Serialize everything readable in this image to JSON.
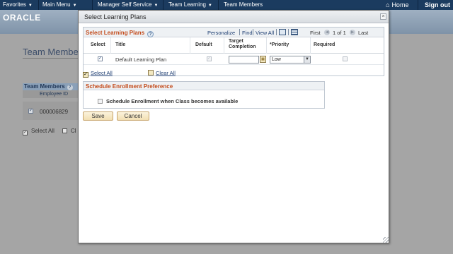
{
  "topbar": {
    "menus": [
      {
        "label": "Favorites"
      },
      {
        "label": "Main Menu"
      },
      {
        "label": "Manager Self Service"
      },
      {
        "label": "Team Learning"
      },
      {
        "label": "Team Members"
      }
    ],
    "home_label": "Home",
    "signout_label": "Sign out"
  },
  "brand": {
    "logo_text": "ORACLE"
  },
  "background_page": {
    "title": "Team Members",
    "grid_title": "Team Members",
    "column_employee_id": "Employee ID",
    "employee_id": "000006829",
    "select_all_label": "Select All",
    "clear_all_partial": "Cl"
  },
  "modal": {
    "title": "Select Learning Plans",
    "close_glyph": "×",
    "grid": {
      "title": "Select Learning Plans",
      "personalize": "Personalize",
      "find": "Find",
      "view_all": "View All",
      "first": "First",
      "page_info": "1 of 1",
      "last": "Last",
      "columns": {
        "select": "Select",
        "title": "Title",
        "default": "Default",
        "target_completion_1": "Target",
        "target_completion_2": "Completion",
        "priority": "*Priority",
        "required": "Required"
      },
      "rows": [
        {
          "selected": true,
          "title": "Default Learning Plan",
          "default": true,
          "target_completion": "",
          "priority": "Low",
          "required": false
        }
      ]
    },
    "select_all_label": "Select All",
    "clear_all_label": "Clear All",
    "preference": {
      "title": "Schedule Enrollment Preference",
      "option_label": "Schedule Enrollment when Class becomes available",
      "option_checked": false
    },
    "save_label": "Save",
    "cancel_label": "Cancel"
  },
  "colors": {
    "topbar": "#1b3b5f",
    "section_title": "#c34a1a",
    "link": "#1f3f73",
    "button_bg": "#f2dfb2"
  }
}
